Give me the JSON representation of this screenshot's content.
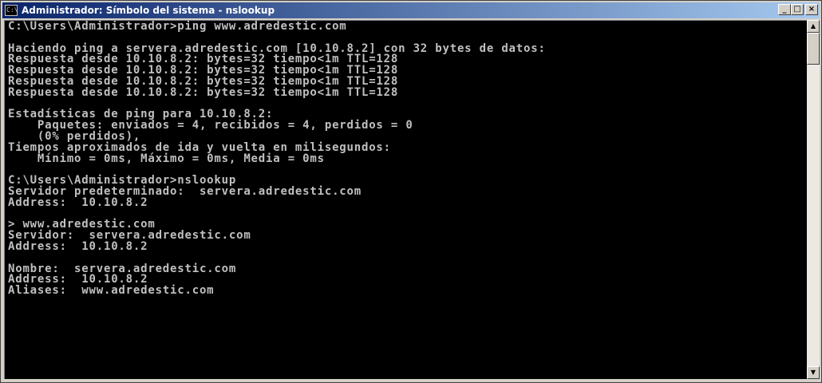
{
  "window": {
    "title": "Administrador: Símbolo del sistema - nslookup",
    "icon_text": "C:\\",
    "buttons": {
      "minimize": "_",
      "maximize": "□",
      "close": "×"
    }
  },
  "console": {
    "lines": [
      "C:\\Users\\Administrador>ping www.adredestic.com",
      "",
      "Haciendo ping a servera.adredestic.com [10.10.8.2] con 32 bytes de datos:",
      "Respuesta desde 10.10.8.2: bytes=32 tiempo<1m TTL=128",
      "Respuesta desde 10.10.8.2: bytes=32 tiempo<1m TTL=128",
      "Respuesta desde 10.10.8.2: bytes=32 tiempo<1m TTL=128",
      "Respuesta desde 10.10.8.2: bytes=32 tiempo<1m TTL=128",
      "",
      "Estadísticas de ping para 10.10.8.2:",
      "    Paquetes: enviados = 4, recibidos = 4, perdidos = 0",
      "    (0% perdidos),",
      "Tiempos aproximados de ida y vuelta en milisegundos:",
      "    Mínimo = 0ms, Máximo = 0ms, Media = 0ms",
      "",
      "C:\\Users\\Administrador>nslookup",
      "Servidor predeterminado:  servera.adredestic.com",
      "Address:  10.10.8.2",
      "",
      "> www.adredestic.com",
      "Servidor:  servera.adredestic.com",
      "Address:  10.10.8.2",
      "",
      "Nombre:  servera.adredestic.com",
      "Address:  10.10.8.2",
      "Aliases:  www.adredestic.com"
    ]
  },
  "scrollbar": {
    "up_arrow": "▲",
    "down_arrow": "▼"
  },
  "colors": {
    "titlebar_start": "#0a246a",
    "titlebar_end": "#a6caf0",
    "console_bg": "#000000",
    "console_text": "#c0c0c0"
  }
}
